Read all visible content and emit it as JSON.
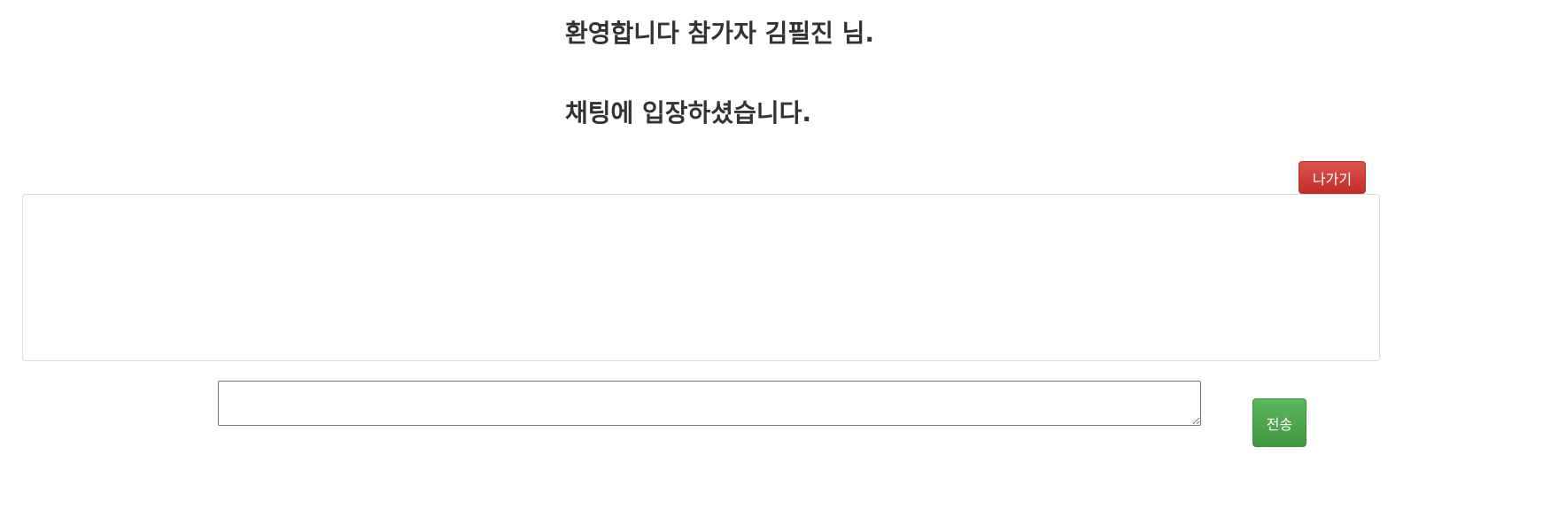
{
  "header": {
    "welcome_text": "환영합니다 참가자 김필진 님.",
    "entered_text": "채팅에 입장하셨습니다."
  },
  "chat": {
    "exit_label": "나가기",
    "messages": []
  },
  "composer": {
    "message_value": "",
    "send_label": "전송"
  },
  "colors": {
    "exit_button": "#d9534f",
    "send_button": "#5cb85c",
    "text": "#333333"
  }
}
